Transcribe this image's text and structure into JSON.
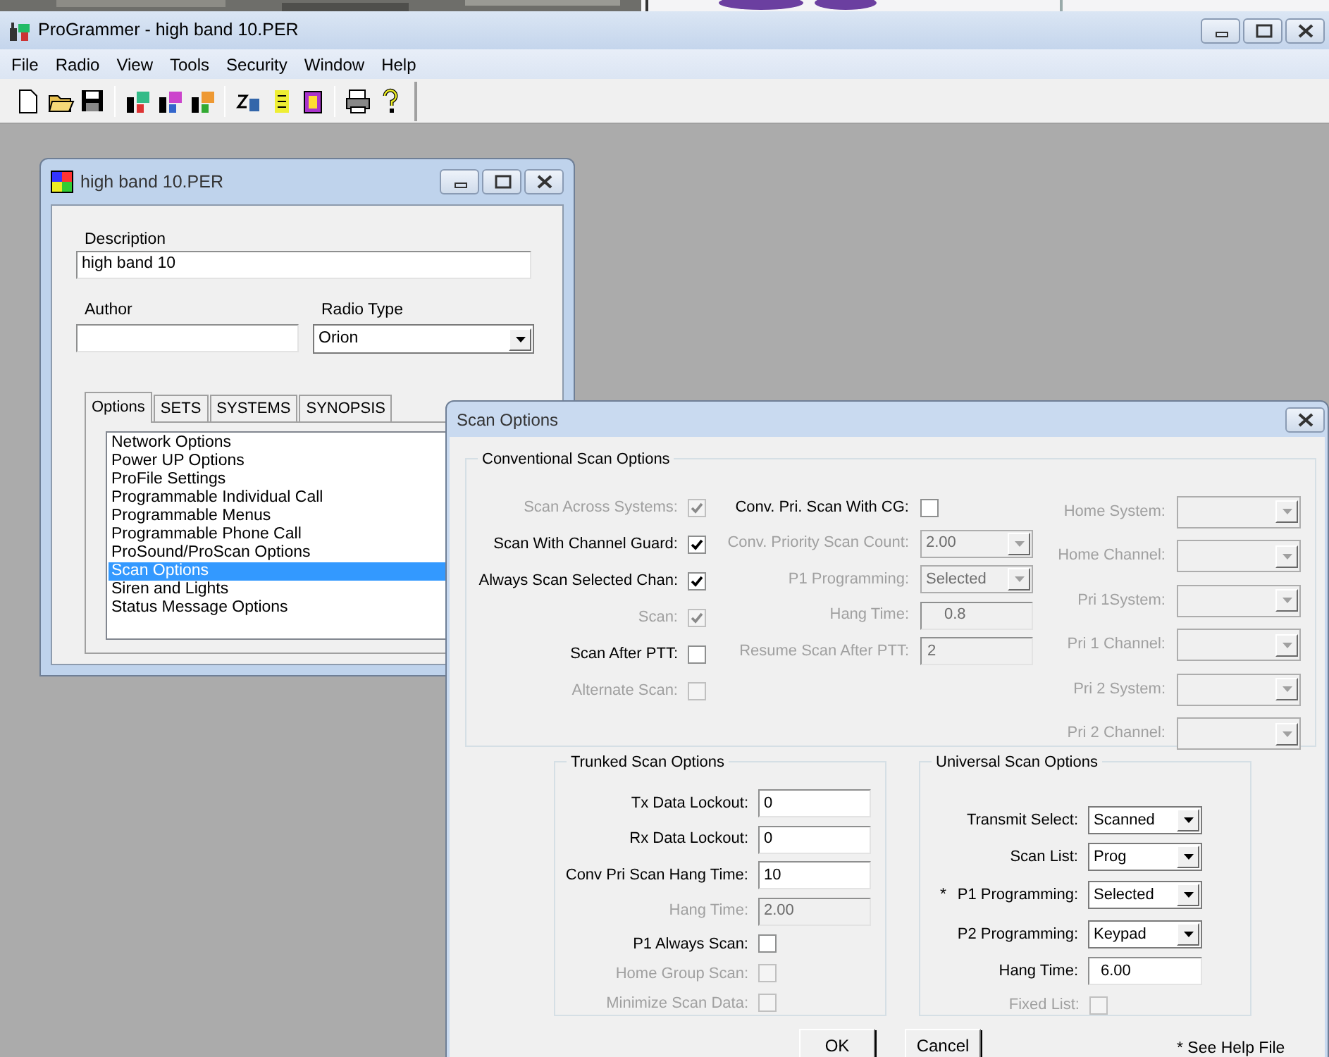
{
  "window": {
    "title": "ProGrammer - high band 10.PER",
    "menu": [
      "File",
      "Radio",
      "View",
      "Tools",
      "Security",
      "Window",
      "Help"
    ]
  },
  "document": {
    "title": "high band 10.PER",
    "description_label": "Description",
    "description": "high band 10",
    "author_label": "Author",
    "radio_type_label": "Radio Type",
    "radio_type": "Orion",
    "tabs": [
      {
        "label": "Options",
        "selected": true
      },
      {
        "label": "SETS",
        "selected": false
      },
      {
        "label": "SYSTEMS",
        "selected": false
      },
      {
        "label": "SYNOPSIS",
        "selected": false
      }
    ],
    "options": [
      {
        "label": "Network Options",
        "selected": false
      },
      {
        "label": "Power UP Options",
        "selected": false
      },
      {
        "label": "ProFile Settings",
        "selected": false
      },
      {
        "label": "Programmable Individual Call",
        "selected": false
      },
      {
        "label": "Programmable Menus",
        "selected": false
      },
      {
        "label": "Programmable Phone Call",
        "selected": false
      },
      {
        "label": "ProSound/ProScan Options",
        "selected": false
      },
      {
        "label": "Scan Options",
        "selected": true
      },
      {
        "label": "Siren and Lights",
        "selected": false
      },
      {
        "label": "Status Message Options",
        "selected": false
      }
    ]
  },
  "scan_options": {
    "title": "Scan Options",
    "conventional": {
      "title": "Conventional Scan Options",
      "column_1": [
        {
          "kind": "checkbox",
          "label": "Scan Across Systems:",
          "checked": true,
          "disabled": true
        },
        {
          "kind": "checkbox",
          "label": "Scan With Channel Guard:",
          "checked": true,
          "disabled": false
        },
        {
          "kind": "checkbox",
          "label": "Always Scan Selected Chan:",
          "checked": true,
          "disabled": false
        },
        {
          "kind": "checkbox",
          "label": "Scan:",
          "checked": true,
          "disabled": true
        },
        {
          "kind": "checkbox",
          "label": "Scan After PTT:",
          "checked": false,
          "disabled": false
        },
        {
          "kind": "checkbox",
          "label": "Alternate Scan:",
          "checked": false,
          "disabled": true
        }
      ],
      "column_2": [
        {
          "kind": "checkbox",
          "label": "Conv. Pri. Scan With CG:",
          "checked": false,
          "disabled": false
        },
        {
          "kind": "dropdown",
          "label": "Conv. Priority Scan Count:",
          "value": "2.00",
          "disabled": true
        },
        {
          "kind": "dropdown",
          "label": "P1 Programming:",
          "value": "Selected",
          "disabled": true
        },
        {
          "kind": "text",
          "label": "Hang Time:",
          "value": "0.8",
          "disabled": true
        },
        {
          "kind": "text",
          "label": "Resume Scan After PTT:",
          "value": "2",
          "disabled": true
        }
      ],
      "column_3": [
        {
          "kind": "dropdown",
          "label": "Home System:",
          "disabled": true
        },
        {
          "kind": "dropdown",
          "label": "Home Channel:",
          "disabled": true
        },
        {
          "kind": "dropdown",
          "label": "Pri 1System:",
          "disabled": true
        },
        {
          "kind": "dropdown",
          "label": "Pri 1 Channel:",
          "disabled": true
        },
        {
          "kind": "dropdown",
          "label": "Pri 2 System:",
          "disabled": true
        },
        {
          "kind": "dropdown",
          "label": "Pri 2 Channel:",
          "disabled": true
        }
      ]
    },
    "trunked": {
      "title": "Trunked Scan Options",
      "rows": [
        {
          "kind": "text",
          "label": "Tx Data Lockout:",
          "value": "0",
          "disabled": false
        },
        {
          "kind": "text",
          "label": "Rx Data Lockout:",
          "value": "0",
          "disabled": false
        },
        {
          "kind": "text",
          "label": "Conv Pri Scan Hang Time:",
          "value": "10",
          "disabled": false
        },
        {
          "kind": "text",
          "label": "Hang Time:",
          "value": "2.00",
          "disabled": true
        },
        {
          "kind": "checkbox",
          "label": "P1 Always Scan:",
          "checked": false,
          "disabled": false
        },
        {
          "kind": "checkbox",
          "label": "Home Group Scan:",
          "checked": false,
          "disabled": true
        },
        {
          "kind": "checkbox",
          "label": "Minimize Scan Data:",
          "checked": false,
          "disabled": true
        }
      ]
    },
    "universal": {
      "title": "Universal Scan Options",
      "rows": [
        {
          "kind": "dropdown",
          "label": "Transmit Select:",
          "value": "Scanned",
          "disabled": false
        },
        {
          "kind": "dropdown",
          "label": "Scan List:",
          "value": "Prog",
          "disabled": false
        },
        {
          "kind": "dropdown",
          "label": "P1 Programming:",
          "value": "Selected",
          "disabled": false,
          "marker": "*"
        },
        {
          "kind": "dropdown",
          "label": "P2 Programming:",
          "value": "Keypad",
          "disabled": false
        },
        {
          "kind": "text",
          "label": "Hang Time:",
          "value": "6.00",
          "disabled": false
        },
        {
          "kind": "checkbox",
          "label": "Fixed List:",
          "checked": false,
          "disabled": true
        }
      ]
    },
    "buttons": [
      "OK",
      "Cancel"
    ],
    "note": "* See Help File"
  }
}
